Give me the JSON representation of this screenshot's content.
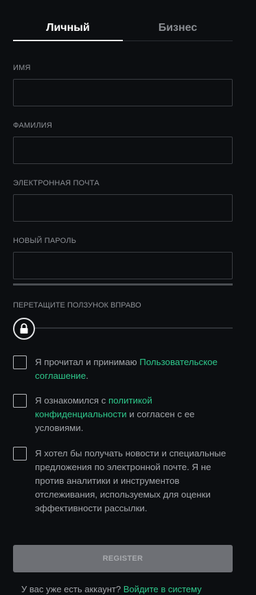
{
  "tabs": [
    {
      "label": "Личный",
      "active": true
    },
    {
      "label": "Бизнес",
      "active": false
    }
  ],
  "fields": {
    "first_name": {
      "label": "ИМЯ",
      "value": ""
    },
    "last_name": {
      "label": "ФАМИЛИЯ",
      "value": ""
    },
    "email": {
      "label": "ЭЛЕКТРОННАЯ ПОЧТА",
      "value": ""
    },
    "password": {
      "label": "НОВЫЙ ПАРОЛЬ",
      "value": ""
    }
  },
  "slider": {
    "label": "ПЕРЕТАЩИТЕ ПОЛЗУНОК ВПРАВО",
    "icon": "lock-icon",
    "progress": 0
  },
  "checkboxes": {
    "terms": {
      "text_before": "Я прочитал и принимаю ",
      "link": "Пользовательское соглашение",
      "text_after": ".",
      "checked": false
    },
    "privacy": {
      "text_before": "Я ознакомился с ",
      "link": "политикой конфиденциальности",
      "text_after": " и согласен с ее условиями.",
      "checked": false
    },
    "newsletter": {
      "text": "Я хотел бы получать новости и специальные предложения по электронной почте. Я не против аналитики и инструментов отслеживания, используемых для оценки эффективности рассылки.",
      "checked": false
    }
  },
  "register_button": "REGISTER",
  "login": {
    "text": "У вас уже есть аккаунт? ",
    "link": "Войдите в систему"
  },
  "colors": {
    "accent": "#2ec98c",
    "background": "#0c0e11",
    "button_disabled": "#6e7075"
  }
}
